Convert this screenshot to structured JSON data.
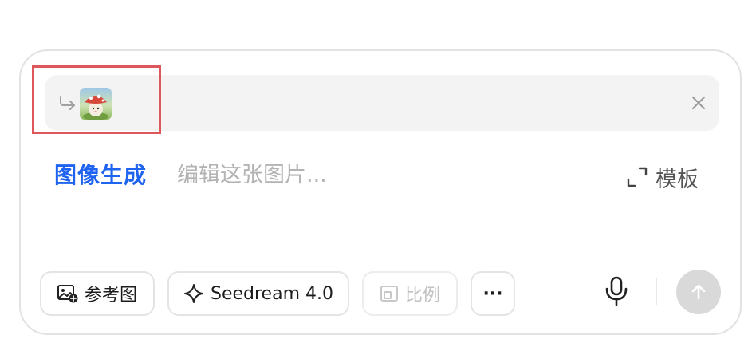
{
  "reference": {
    "thumbnail_icon": "mushroom-character-thumbnail",
    "close_icon": "close-icon"
  },
  "composer": {
    "mode_label": "图像生成",
    "prompt_placeholder": "编辑这张图片...",
    "prompt_value": "",
    "template_label": "模板"
  },
  "toolbar": {
    "reference_image_label": "参考图",
    "model_label": "Seedream 4.0",
    "ratio_label": "比例",
    "more_label": "···"
  },
  "colors": {
    "accent": "#1e64f0",
    "highlight_box": "#e0575b",
    "send_disabled": "#d9d9d9"
  }
}
